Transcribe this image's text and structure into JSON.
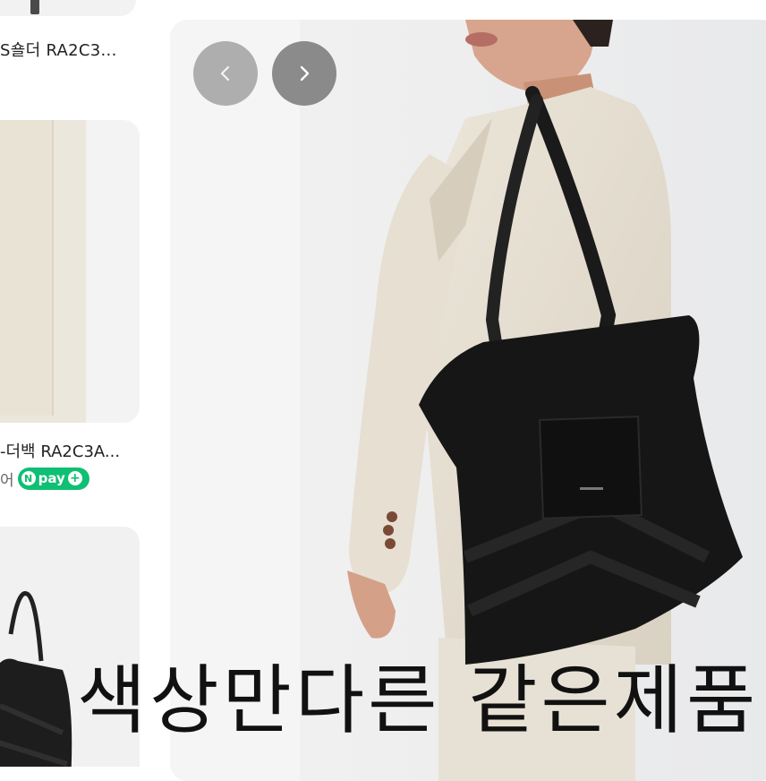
{
  "product_list": {
    "items": [
      {
        "title": "S숄더 RA2C3..."
      },
      {
        "title": "-더백 RA2C3A...",
        "seller": "어",
        "badge": "pay"
      },
      {
        "title": ""
      }
    ]
  },
  "gallery": {
    "prev_icon": "chevron-left-icon",
    "next_icon": "chevron-right-icon"
  },
  "overlay_caption": "색상만다른 같은제품"
}
